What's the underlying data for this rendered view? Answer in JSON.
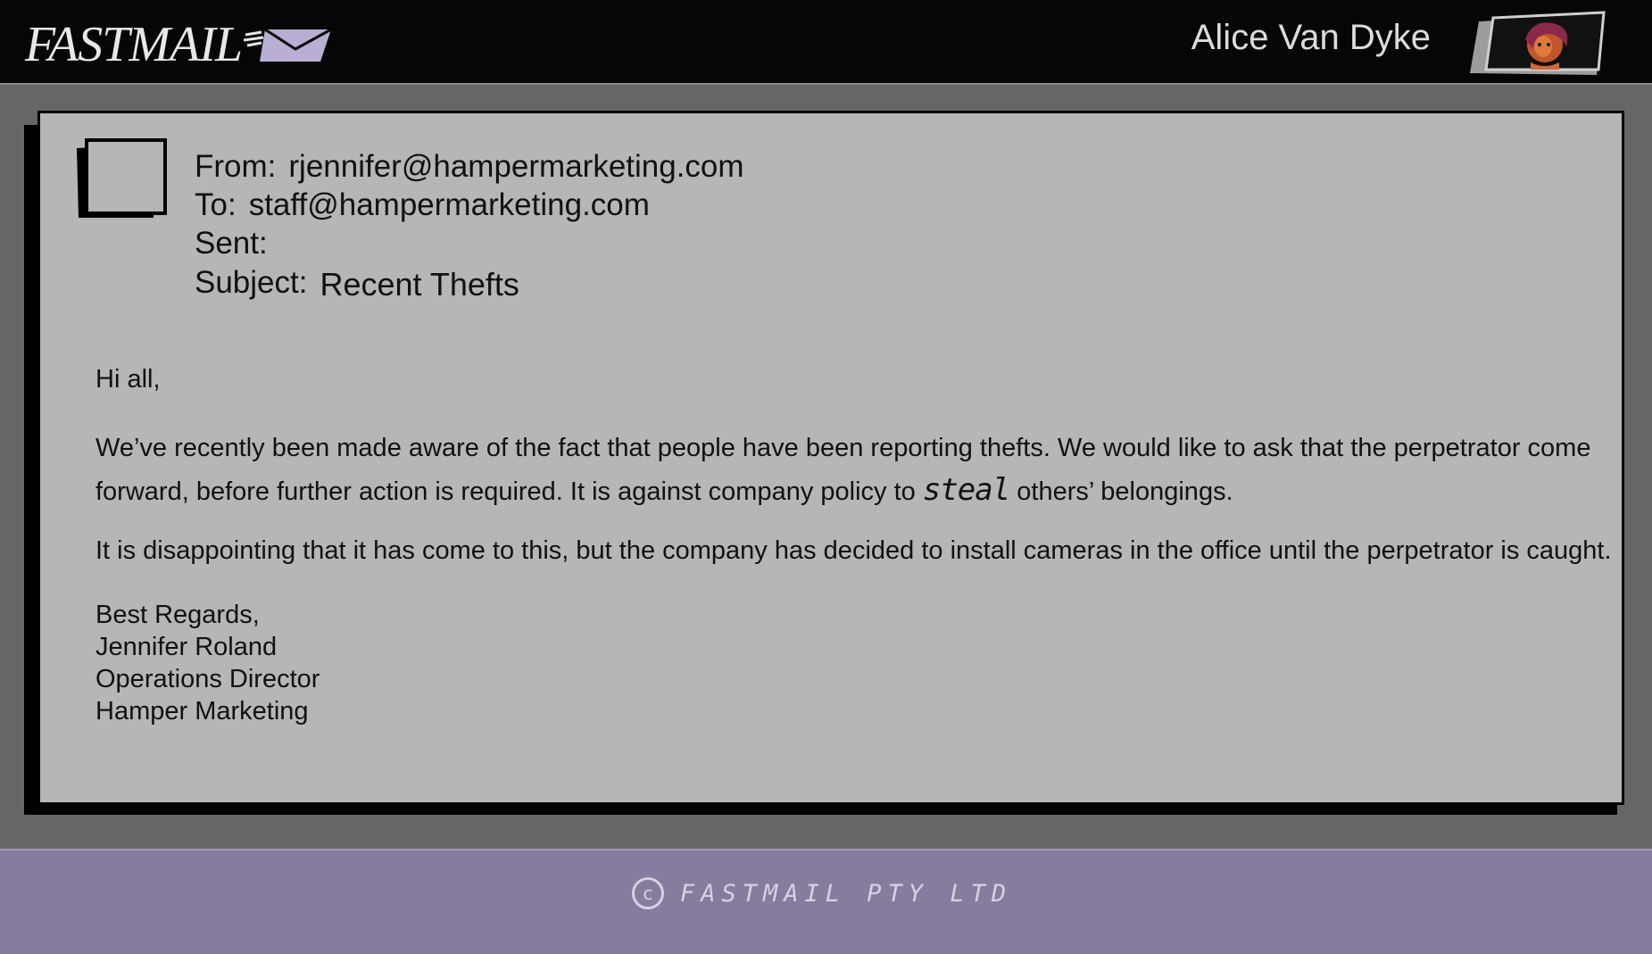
{
  "app": {
    "logo_text": "FASTMAIL",
    "user_name": "Alice Van Dyke"
  },
  "email": {
    "from_label": "From:",
    "from_value": "rjennifer@hampermarketing.com",
    "to_label": "To:",
    "to_value": "staff@hampermarketing.com",
    "sent_label": "Sent:",
    "sent_value": "",
    "subject_label": "Subject:",
    "subject_value": "Recent Thefts",
    "greeting": "Hi all,",
    "para1_before": "We’ve recently been made aware of the fact that people have been reporting thefts. We would like to ask that the perpetrator come forward, before further action is required. It is against company policy to ",
    "para1_handwritten": "steal",
    "para1_after": " others’ belongings.",
    "para2": "It is disappointing that it has come to this, but the company has decided to install cameras in the office until the perpetrator is caught.",
    "signature": {
      "closing": "Best Regards,",
      "name": "Jennifer Roland",
      "title": "Operations Director",
      "company": "Hamper Marketing"
    }
  },
  "footer": {
    "copyright_symbol": "c",
    "text": "FASTMAIL PTY LTD"
  },
  "icons": {
    "logo_envelope": "envelope-icon",
    "avatar": "user-avatar-image",
    "sender": "sender-avatar-placeholder-icon",
    "copyright": "copyright-icon"
  },
  "colors": {
    "topbar": "#060606",
    "page_background": "#666666",
    "card_background": "#b6b6b6",
    "footer_background": "#857c9e",
    "envelope": "#b9aed3"
  }
}
